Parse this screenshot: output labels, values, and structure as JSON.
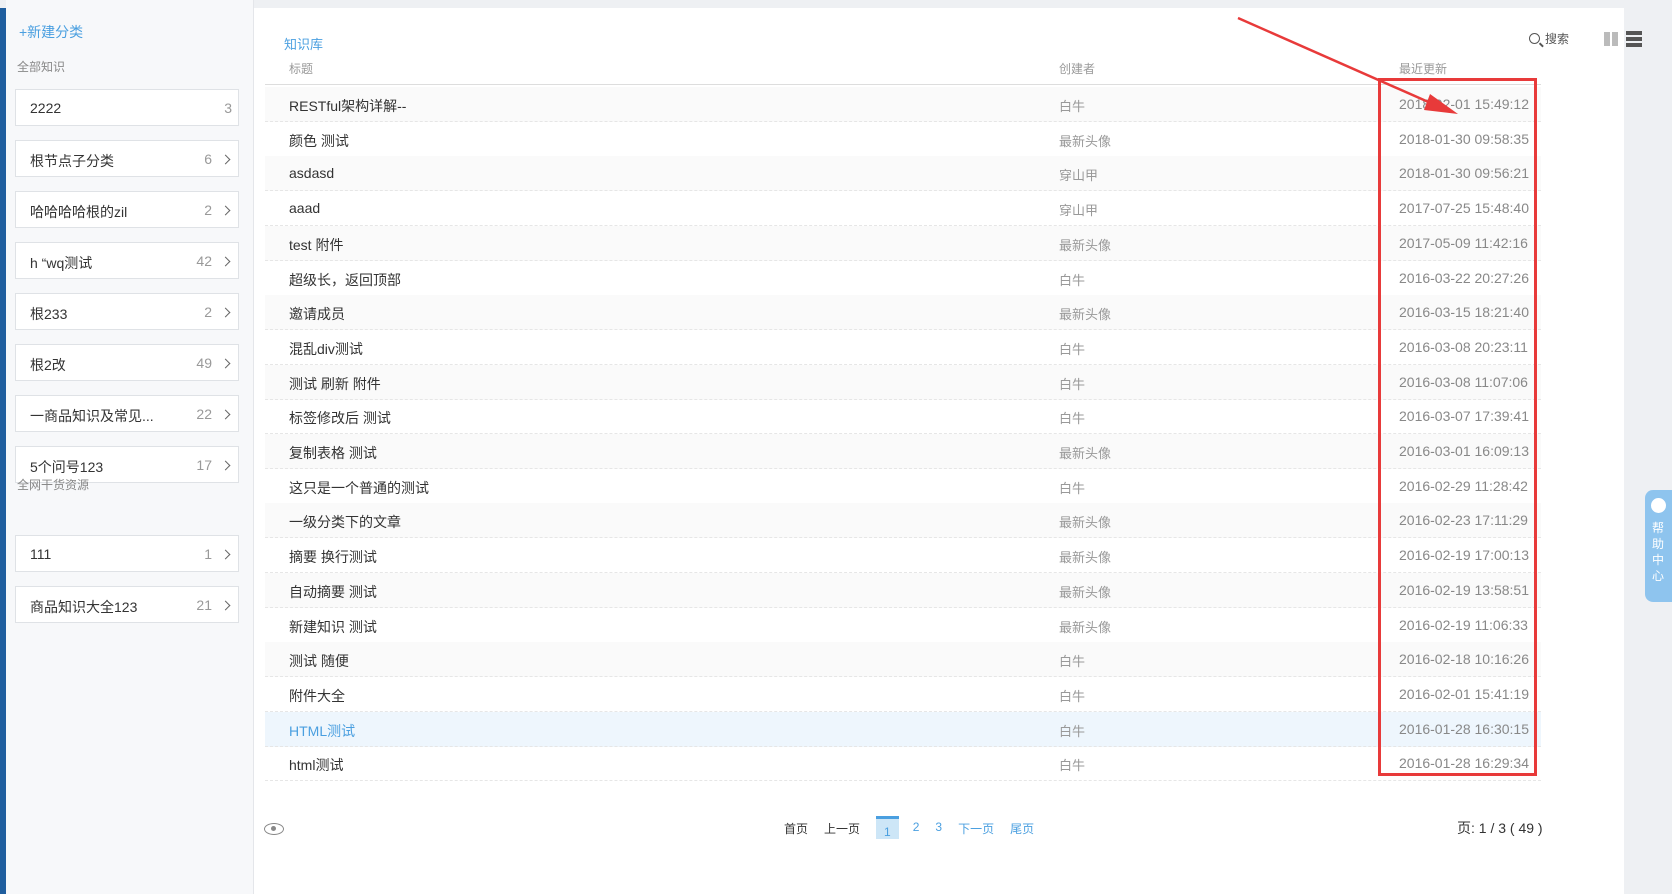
{
  "sidebar": {
    "new_category": "+新建分类",
    "section1_title": "全部知识",
    "section1_items": [
      {
        "name": "2222",
        "count": "3",
        "arrow": false
      },
      {
        "name": "根节点子分类",
        "count": "6",
        "arrow": true
      },
      {
        "name": "哈哈哈哈根的zil",
        "count": "2",
        "arrow": true
      },
      {
        "name": "h “wq测试",
        "count": "42",
        "arrow": true
      },
      {
        "name": "根233",
        "count": "2",
        "arrow": true
      },
      {
        "name": "根2改",
        "count": "49",
        "arrow": true
      },
      {
        "name": "一商品知识及常见...",
        "count": "22",
        "arrow": true
      },
      {
        "name": "5个问号123",
        "count": "17",
        "arrow": true
      }
    ],
    "section2_title": "全网干货资源",
    "section2_items": [
      {
        "name": "111",
        "count": "1",
        "arrow": true
      },
      {
        "name": "商品知识大全123",
        "count": "21",
        "arrow": true
      }
    ]
  },
  "main": {
    "title": "知识库",
    "search_label": "搜索",
    "columns": {
      "title": "标题",
      "creator": "创建者",
      "updated": "最近更新"
    },
    "rows": [
      {
        "title": "RESTful架构详解--",
        "creator": "白牛",
        "date": "2018-02-01 15:49:12"
      },
      {
        "title": "颜色 测试",
        "creator": "最新头像",
        "date": "2018-01-30 09:58:35"
      },
      {
        "title": "asdasd",
        "creator": "穿山甲",
        "date": "2018-01-30 09:56:21"
      },
      {
        "title": "aaad",
        "creator": "穿山甲",
        "date": "2017-07-25 15:48:40"
      },
      {
        "title": "test 附件",
        "creator": "最新头像",
        "date": "2017-05-09 11:42:16"
      },
      {
        "title": "超级长，返回顶部",
        "creator": "白牛",
        "date": "2016-03-22 20:27:26"
      },
      {
        "title": "邀请成员",
        "creator": "最新头像",
        "date": "2016-03-15 18:21:40"
      },
      {
        "title": "混乱div测试",
        "creator": "白牛",
        "date": "2016-03-08 20:23:11"
      },
      {
        "title": "测试 刷新 附件",
        "creator": "白牛",
        "date": "2016-03-08 11:07:06"
      },
      {
        "title": "标签修改后 测试",
        "creator": "白牛",
        "date": "2016-03-07 17:39:41"
      },
      {
        "title": "复制表格 测试",
        "creator": "最新头像",
        "date": "2016-03-01 16:09:13"
      },
      {
        "title": "这只是一个普通的测试",
        "creator": "白牛",
        "date": "2016-02-29 11:28:42"
      },
      {
        "title": "一级分类下的文章",
        "creator": "最新头像",
        "date": "2016-02-23 17:11:29"
      },
      {
        "title": "摘要 换行测试",
        "creator": "最新头像",
        "date": "2016-02-19 17:00:13"
      },
      {
        "title": "自动摘要 测试",
        "creator": "最新头像",
        "date": "2016-02-19 13:58:51"
      },
      {
        "title": "新建知识 测试",
        "creator": "最新头像",
        "date": "2016-02-19 11:06:33"
      },
      {
        "title": "测试 随便",
        "creator": "白牛",
        "date": "2016-02-18 10:16:26"
      },
      {
        "title": "附件大全",
        "creator": "白牛",
        "date": "2016-02-01 15:41:19"
      },
      {
        "title": "HTML测试",
        "creator": "白牛",
        "date": "2016-01-28 16:30:15"
      },
      {
        "title": "html测试",
        "creator": "白牛",
        "date": "2016-01-28 16:29:34"
      }
    ],
    "highlighted_row_index": 18
  },
  "pagination": {
    "first": "首页",
    "prev": "上一页",
    "pages": [
      "1",
      "2",
      "3"
    ],
    "current": "1",
    "next": "下一页",
    "last": "尾页",
    "info": "页: 1 / 3 ( 49 )"
  },
  "help": {
    "label": "帮助中心"
  },
  "colors": {
    "accent": "#4a9fe0",
    "annotation_red": "#e83a3a",
    "help_tab": "#8ec4ee"
  }
}
